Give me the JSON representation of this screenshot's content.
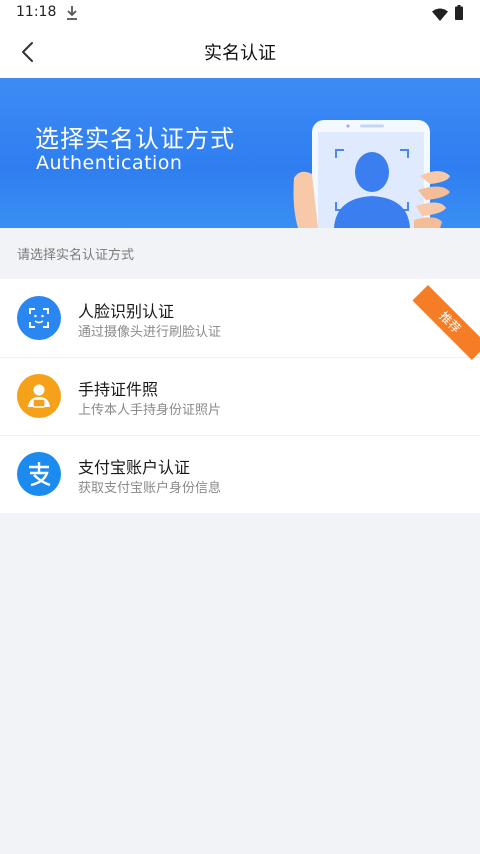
{
  "status_bar": {
    "time": "11:18",
    "icons": [
      "download-icon",
      "wifi-icon",
      "battery-icon"
    ]
  },
  "nav": {
    "title": "实名认证",
    "back_icon": "back-chevron-icon"
  },
  "banner": {
    "title": "选择实名认证方式",
    "subtitle": "Authentication"
  },
  "section_hint": "请选择实名认证方式",
  "options": [
    {
      "title": "人脸识别认证",
      "desc": "通过摄像头进行刷脸认证",
      "icon": "face-scan-icon",
      "icon_color": "#2a86f0",
      "badge": "推荐",
      "badge_color": "#f47d25"
    },
    {
      "title": "手持证件照",
      "desc": "上传本人手持身份证照片",
      "icon": "hold-id-icon",
      "icon_color": "#f5a21a"
    },
    {
      "title": "支付宝账户认证",
      "desc": "获取支付宝账户身份信息",
      "icon": "alipay-icon",
      "icon_color": "#1b8bf0"
    }
  ],
  "colors": {
    "banner_blue": "#2f7ef0",
    "page_background": "#f2f3f7"
  }
}
